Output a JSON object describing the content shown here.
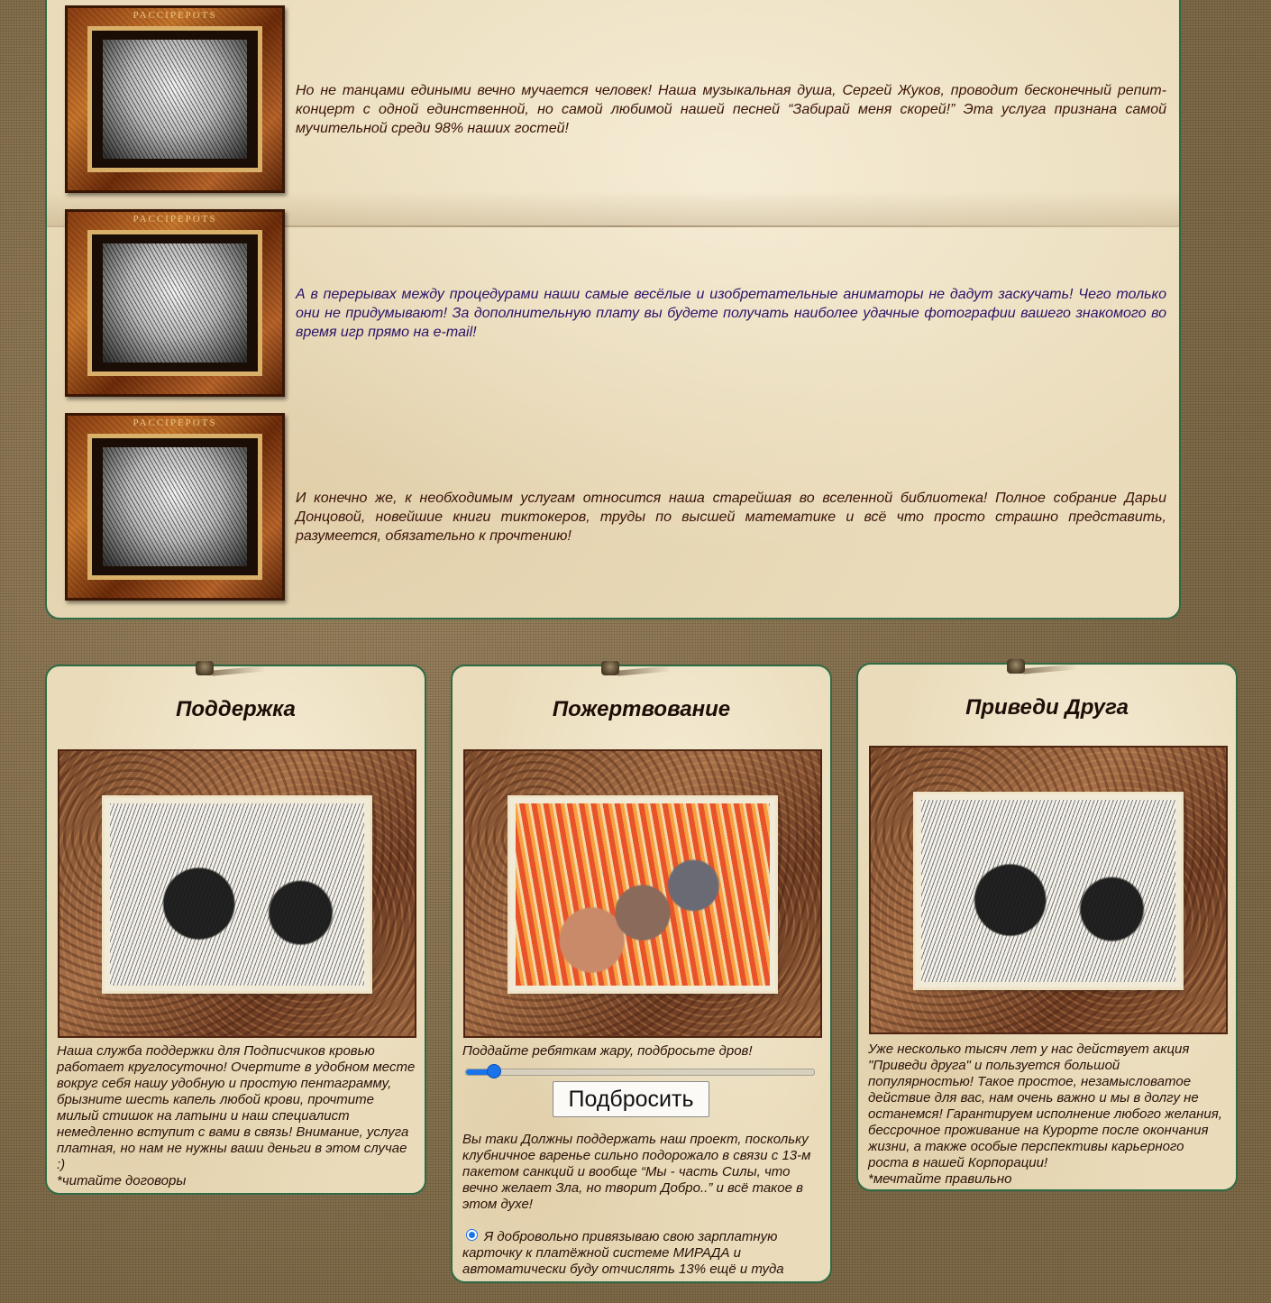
{
  "top_section": {
    "rows": [
      {
        "frame_letters": "PACCIPEPOTS",
        "text": "Но не танцами едиными вечно мучается человек! Наша музыкальная душа, Сергей Жуков, проводит бесконечный репит-концерт с одной единственной, но самой любимой нашей песней “Забирай меня скорей!” Эта услуга признана самой мучительной среди 98% наших гостей!"
      },
      {
        "frame_letters": "PACCIPEPOTS",
        "text": "А в перерывах между процедурами наши самые весёлые и изобретательные аниматоры не дадут заскучать! Чего только они не придумывают! За дополнительную плату вы будете получать наиболее удачные фотографии вашего знакомого во время игр прямо на e-mail!"
      },
      {
        "frame_letters": "PACCIPEPOTS",
        "text": "И конечно же, к необходимым услугам относится наша старейшая во вселенной библиотека! Полное собрание Дарьи Донцовой, новейшие книги тиктокеров, труды по высшей математике и всё что просто страшно представить, разумеется, обязательно к прочтению!"
      }
    ]
  },
  "cards": {
    "support": {
      "title": "Поддержка",
      "text": "Наша служба поддержки для Подписчиков кровью работает круглосуточно! Очертите в удобном месте вокруг себя нашу удобную и простую пентаграмму, брызните шесть капель любой крови, прочтите милый стишок на латыни и наш специалист немедленно вступит с вами в связь! Внимание, услуга платная, но нам не нужны ваши деньги в этом случае :)",
      "note": "*читайте договоры"
    },
    "donation": {
      "title": "Пожертвование",
      "slider_label": "Поддайте ребяткам жару, подбросьте дров!",
      "slider_value_percent": 8,
      "button_label": "Подбросить",
      "text": "Вы таки Должны поддержать наш проект, поскольку клубничное варенье сильно подорожало в связи с 13-м пакетом санкций и вообще “Мы - часть Силы, что вечно желает Зла, но творит Добро..” и всё такое в этом духе!",
      "radio_label": "Я добровольно привязываю свою зарплатную карточку к платёжной системе МИРАДА и автоматически буду отчислять 13% ещё и туда",
      "radio_checked": true
    },
    "referral": {
      "title": "Приведи Друга",
      "text": "Уже несколько тысяч лет у нас действует акция \"Приведи друга\" и пользуется большой популярностью! Такое простое, незамысловатое действие для вас, нам очень важно и мы в долгу не останемся! Гарантируем исполнение любого желания, бессрочное проживание на Курорте после окончания жизни, а также особые перспективы карьерного роста в нашей Корпорации!",
      "note": "*мечтайте правильно"
    }
  },
  "colors": {
    "panel_border": "#2e6b45",
    "text_brown": "#3a1208",
    "text_indigo": "#2a1268",
    "accent_blue": "#1a73e8"
  }
}
